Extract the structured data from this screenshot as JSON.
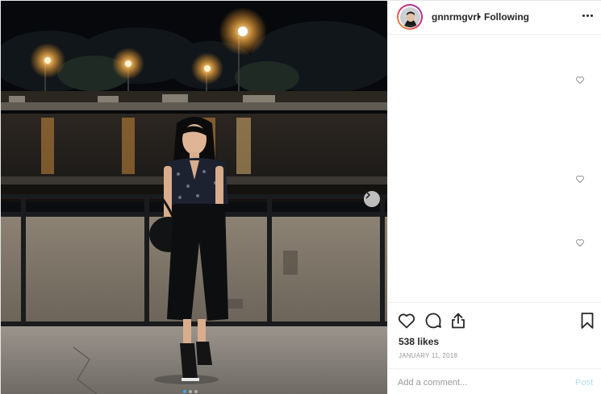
{
  "header": {
    "username": "gnnrmgvrl",
    "separator": "•",
    "follow_status": "Following"
  },
  "photo": {
    "image_count": 3,
    "active_index": 0
  },
  "comments": {
    "like_icon": "heart-outline-icon",
    "count_visible": 3
  },
  "actions": {
    "like_icon": "heart-outline-icon",
    "comment_icon": "comment-bubble-icon",
    "share_icon": "share-upload-icon",
    "save_icon": "bookmark-icon"
  },
  "likes_text": "538 likes",
  "date_text": "JANUARY 11, 2018",
  "add_comment": {
    "placeholder": "Add a comment...",
    "post_label": "Post"
  },
  "colors": {
    "text": "#262626",
    "muted": "#999999",
    "post_disabled": "#b2dffc",
    "border": "#efefef"
  }
}
